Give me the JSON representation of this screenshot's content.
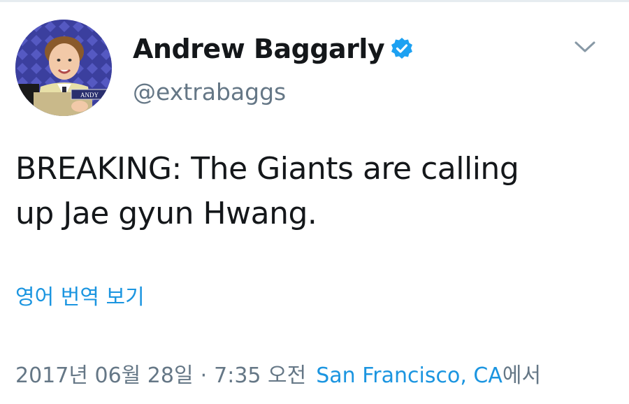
{
  "author": {
    "display_name": "Andrew Baggarly",
    "handle": "@extrabaggs",
    "avatar_nameplate": "ANDY"
  },
  "tweet": {
    "text_line1": "BREAKING: The Giants are calling",
    "text_line2": "up Jae gyun Hwang.",
    "translate_label": "영어 번역 보기"
  },
  "meta": {
    "date": "2017년 06월 28일",
    "separator": "·",
    "time": "7:35 오전",
    "location": "San Francisco, CA",
    "location_suffix": "에서"
  },
  "icons": {
    "verified": "verified-badge-icon",
    "more": "chevron-down-icon"
  },
  "colors": {
    "link": "#1b95e0",
    "secondary_text": "#657786",
    "primary_text": "#14171a",
    "verified": "#1da1f2"
  }
}
